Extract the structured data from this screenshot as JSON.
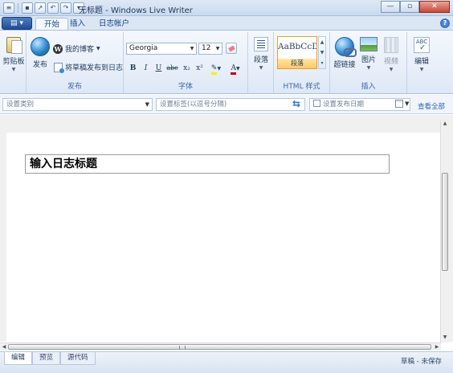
{
  "window": {
    "title": "无标题 - Windows Live Writer",
    "controls": {
      "minimize": "—",
      "maximize": "▫",
      "close": "✕"
    }
  },
  "tabs": [
    {
      "label": "开始",
      "active": true
    },
    {
      "label": "插入",
      "active": false
    },
    {
      "label": "日志帐户",
      "active": false
    }
  ],
  "ribbon": {
    "clipboard": {
      "label": "剪贴板"
    },
    "publish": {
      "publish_label": "发布",
      "my_blog_label": "我的博客",
      "post_draft_label": "将草稿发布到日志",
      "group_label": "发布"
    },
    "font": {
      "family": "Georgia",
      "size": "12",
      "group_label": "字体",
      "buttons": {
        "bold": "B",
        "italic": "I",
        "underline": "U",
        "strike": "abc",
        "sub": "x₂",
        "sup": "x²",
        "color": "A"
      }
    },
    "paragraph": {
      "label": "段落"
    },
    "html_style": {
      "sample": "AaBbCcD",
      "style_name": "段落",
      "group_label": "HTML 样式"
    },
    "insert": {
      "hyperlink_label": "超链接",
      "picture_label": "图片",
      "video_label": "视频",
      "group_label": "插入"
    },
    "editing": {
      "label": "编辑"
    }
  },
  "fieldbar": {
    "category_placeholder": "设置类别",
    "tags_placeholder": "设置标签(以逗号分隔)",
    "publish_date_label": "设置发布日期",
    "view_all_label": "查看全部"
  },
  "editor": {
    "title_placeholder": "输入日志标题"
  },
  "view_tabs": [
    {
      "label": "编辑",
      "active": true
    },
    {
      "label": "预览",
      "active": false
    },
    {
      "label": "源代码",
      "active": false
    }
  ],
  "status": "草稿 - 未保存",
  "colors": {
    "accent": "#15428b",
    "ribbon_bg": "#e8eff9",
    "highlight": "#fcc66a"
  }
}
